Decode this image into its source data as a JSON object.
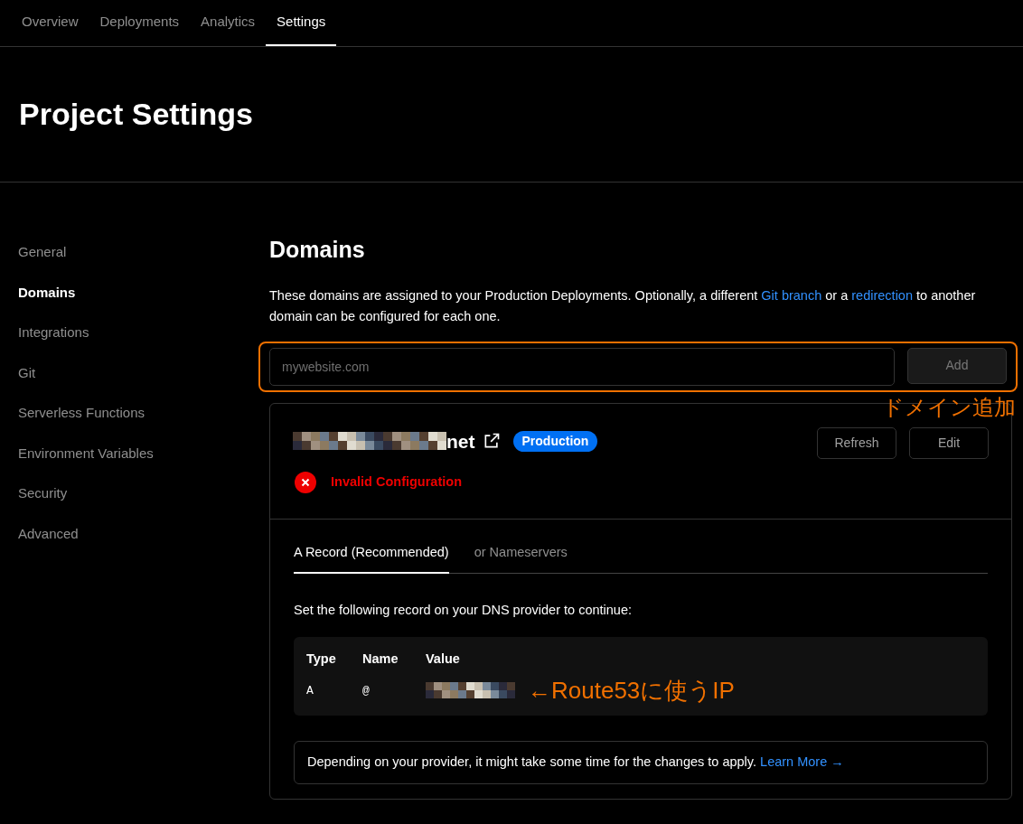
{
  "nav_tabs": [
    {
      "label": "Overview",
      "selected": false
    },
    {
      "label": "Deployments",
      "selected": false
    },
    {
      "label": "Analytics",
      "selected": false
    },
    {
      "label": "Settings",
      "selected": true
    }
  ],
  "page_title": "Project Settings",
  "sidebar": {
    "items": [
      {
        "label": "General",
        "selected": false
      },
      {
        "label": "Domains",
        "selected": true
      },
      {
        "label": "Integrations",
        "selected": false
      },
      {
        "label": "Git",
        "selected": false
      },
      {
        "label": "Serverless Functions",
        "selected": false
      },
      {
        "label": "Environment Variables",
        "selected": false
      },
      {
        "label": "Security",
        "selected": false
      },
      {
        "label": "Advanced",
        "selected": false
      }
    ]
  },
  "domains": {
    "title": "Domains",
    "description_before": "These domains are assigned to your Production Deployments. Optionally, a different ",
    "link_1": "Git branch",
    "description_middle": " or a ",
    "link_2": "redirection",
    "description_after": " to another domain can be configured for each one.",
    "input": {
      "placeholder": "mywebsite.com"
    },
    "add_button": "Add",
    "annotation_add": "ドメイン追加",
    "domain": {
      "name_suffix": "net",
      "badge": "Production",
      "status": "Invalid Configuration",
      "buttons": [
        "Refresh",
        "Edit"
      ],
      "tabs": [
        {
          "label": "A Record (Recommended)",
          "selected": true
        },
        {
          "label": "or Nameservers",
          "selected": false
        }
      ],
      "instruction": "Set the following record on your DNS provider to continue:",
      "record": {
        "columns": [
          "Type",
          "Name",
          "Value"
        ],
        "type": "A",
        "name": "@",
        "annotation": "←Route53に使うIP"
      },
      "note": "Depending on your provider, it might take some time for the changes to apply.",
      "note_link": "Learn More →"
    }
  }
}
